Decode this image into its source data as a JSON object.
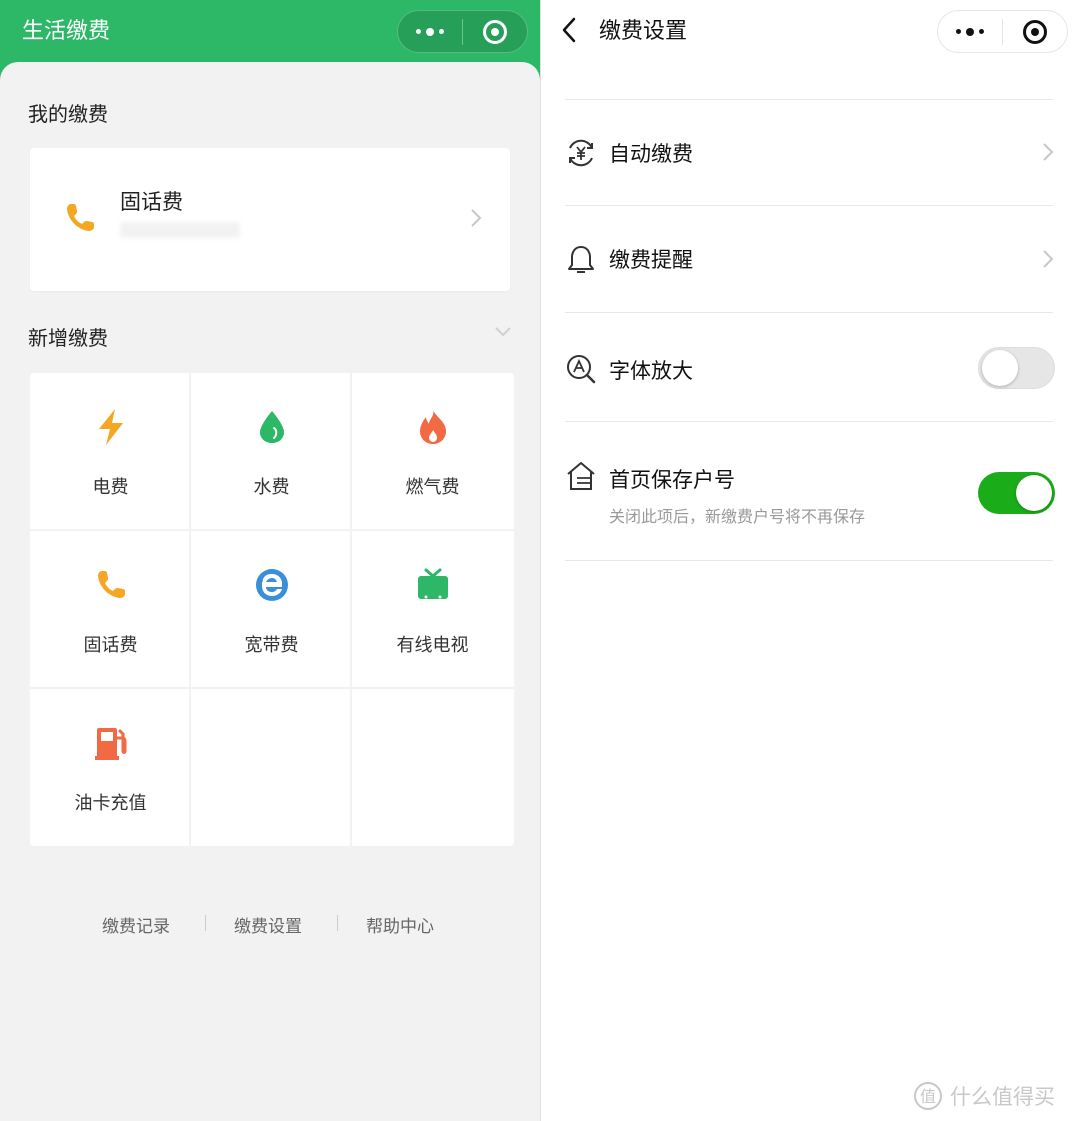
{
  "left": {
    "header": {
      "title": "生活缴费"
    },
    "my_bills": {
      "section_title": "我的缴费",
      "card": {
        "name": "固话费",
        "icon": "phone-icon",
        "account": ""
      }
    },
    "new_bills": {
      "section_title": "新增缴费",
      "items": [
        {
          "label": "电费",
          "icon": "lightning-icon",
          "color": "#f5a623"
        },
        {
          "label": "水费",
          "icon": "water-drop-icon",
          "color": "#2cb866"
        },
        {
          "label": "燃气费",
          "icon": "flame-icon",
          "color": "#f26a43"
        },
        {
          "label": "固话费",
          "icon": "phone-icon",
          "color": "#f5a623"
        },
        {
          "label": "宽带费",
          "icon": "broadband-e-icon",
          "color": "#3a8fd9"
        },
        {
          "label": "有线电视",
          "icon": "tv-icon",
          "color": "#2cb866"
        },
        {
          "label": "油卡充值",
          "icon": "fuel-pump-icon",
          "color": "#f26a43"
        }
      ]
    },
    "footer_links": [
      "缴费记录",
      "缴费设置",
      "帮助中心"
    ]
  },
  "right": {
    "header": {
      "title": "缴费设置"
    },
    "rows": [
      {
        "label": "自动缴费",
        "icon": "yen-cycle-icon"
      },
      {
        "label": "缴费提醒",
        "icon": "bell-icon"
      },
      {
        "label": "字体放大",
        "icon": "font-zoom-icon",
        "toggle": false
      },
      {
        "label": "首页保存户号",
        "icon": "home-icon",
        "sublabel": "关闭此项后，新缴费户号将不再保存",
        "toggle": true
      }
    ]
  },
  "watermark": {
    "text": "什么值得买",
    "icon": "smzdm-logo-icon"
  },
  "colors": {
    "brand_green": "#2cb866",
    "toggle_green": "#1aad19",
    "bg_gray": "#f2f2f2"
  }
}
